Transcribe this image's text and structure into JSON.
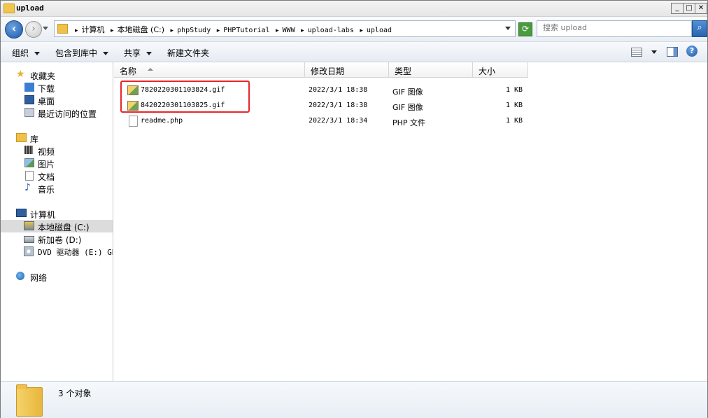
{
  "window": {
    "title": "upload"
  },
  "titlebar": {
    "min": "_",
    "max": "□",
    "close": "✕"
  },
  "address": {
    "crumbs": [
      "计算机",
      "本地磁盘 (C:)",
      "phpStudy",
      "PHPTutorial",
      "WWW",
      "upload-labs",
      "upload"
    ],
    "search_placeholder": "搜索 upload"
  },
  "toolbar": {
    "organize": "组织",
    "include_in_library": "包含到库中",
    "share": "共享",
    "new_folder": "新建文件夹"
  },
  "nav": {
    "favorites": {
      "label": "收藏夹",
      "items": [
        "下载",
        "桌面",
        "最近访问的位置"
      ]
    },
    "libraries": {
      "label": "库",
      "items": [
        "视频",
        "图片",
        "文档",
        "音乐"
      ]
    },
    "computer": {
      "label": "计算机",
      "items": [
        "本地磁盘 (C:)",
        "新加卷 (D:)",
        "DVD 驱动器 (E:) GR"
      ]
    },
    "network": {
      "label": "网络"
    }
  },
  "columns": {
    "name": "名称",
    "date": "修改日期",
    "type": "类型",
    "size": "大小"
  },
  "files": [
    {
      "name": "7820220301103824.gif",
      "date": "2022/3/1 18:38",
      "type": "GIF 图像",
      "size": "1 KB",
      "icon": "gif-image-icon"
    },
    {
      "name": "8420220301103825.gif",
      "date": "2022/3/1 18:38",
      "type": "GIF 图像",
      "size": "1 KB",
      "icon": "gif-image-icon"
    },
    {
      "name": "readme.php",
      "date": "2022/3/1 18:34",
      "type": "PHP 文件",
      "size": "1 KB",
      "icon": "php-file-icon"
    }
  ],
  "highlight_color": "#e8262b",
  "status": {
    "count": "3 个对象"
  }
}
